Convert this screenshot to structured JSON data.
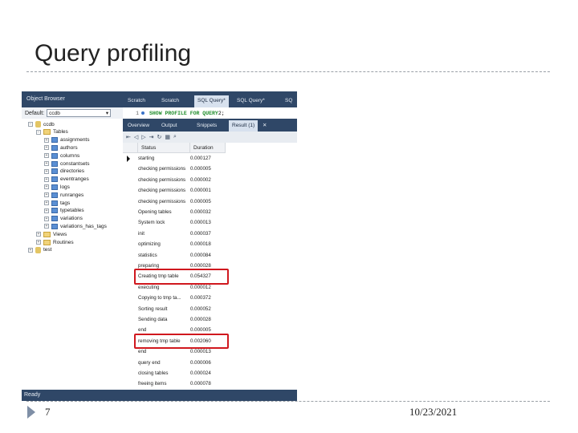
{
  "slide": {
    "title": "Query profiling",
    "page_number": "7",
    "date": "10/23/2021"
  },
  "object_browser": {
    "header": "Object Browser",
    "default_label": "Default:",
    "default_value": "ccdb",
    "tree": [
      {
        "label": "ccdb",
        "type": "db",
        "expander": "−"
      },
      {
        "label": "Tables",
        "type": "folder",
        "expander": "−"
      },
      {
        "label": "assignments",
        "type": "table",
        "expander": "+"
      },
      {
        "label": "authors",
        "type": "table",
        "expander": "+"
      },
      {
        "label": "columns",
        "type": "table",
        "expander": "+"
      },
      {
        "label": "constantsets",
        "type": "table",
        "expander": "+"
      },
      {
        "label": "directories",
        "type": "table",
        "expander": "+"
      },
      {
        "label": "eventranges",
        "type": "table",
        "expander": "+"
      },
      {
        "label": "logs",
        "type": "table",
        "expander": "+"
      },
      {
        "label": "runranges",
        "type": "table",
        "expander": "+"
      },
      {
        "label": "tags",
        "type": "table",
        "expander": "+"
      },
      {
        "label": "typetables",
        "type": "table",
        "expander": "+"
      },
      {
        "label": "variations",
        "type": "table",
        "expander": "+"
      },
      {
        "label": "variations_has_tags",
        "type": "table",
        "expander": "+"
      },
      {
        "label": "Views",
        "type": "folder",
        "expander": "+"
      },
      {
        "label": "Routines",
        "type": "folder",
        "expander": "+"
      },
      {
        "label": "test",
        "type": "db",
        "expander": "+"
      }
    ]
  },
  "editor_tabs": [
    {
      "label": "Scratch"
    },
    {
      "label": "Scratch"
    },
    {
      "label": "SQL Query*"
    },
    {
      "label": "SQL Query*"
    },
    {
      "label": "SQ"
    }
  ],
  "editor": {
    "line_number": "1",
    "kw1": "SHOW PROFILE FOR QUERY",
    "rest": " 2;"
  },
  "result_tabs": [
    {
      "label": "Overview"
    },
    {
      "label": "Output"
    },
    {
      "label": "Snippets"
    },
    {
      "label": "Result (1)"
    },
    {
      "label": "✕"
    }
  ],
  "grid": {
    "headers": {
      "status": "Status",
      "duration": "Duration"
    },
    "rows": [
      {
        "status": "starting",
        "duration": "0.000127"
      },
      {
        "status": "checking permissions",
        "duration": "0.000005"
      },
      {
        "status": "checking permissions",
        "duration": "0.000002"
      },
      {
        "status": "checking permissions",
        "duration": "0.000001"
      },
      {
        "status": "checking permissions",
        "duration": "0.000005"
      },
      {
        "status": "Opening tables",
        "duration": "0.000032"
      },
      {
        "status": "System lock",
        "duration": "0.000013"
      },
      {
        "status": "init",
        "duration": "0.000037"
      },
      {
        "status": "optimizing",
        "duration": "0.000018"
      },
      {
        "status": "statistics",
        "duration": "0.000084"
      },
      {
        "status": "preparing",
        "duration": "0.000028"
      },
      {
        "status": "Creating tmp table",
        "duration": "0.054327"
      },
      {
        "status": "executing",
        "duration": "0.000012"
      },
      {
        "status": "Copying to tmp ta...",
        "duration": "0.000372"
      },
      {
        "status": "Sorting result",
        "duration": "0.000052"
      },
      {
        "status": "Sending data",
        "duration": "0.000028"
      },
      {
        "status": "end",
        "duration": "0.000005"
      },
      {
        "status": "removing tmp table",
        "duration": "0.002060"
      },
      {
        "status": "end",
        "duration": "0.000013"
      },
      {
        "status": "query end",
        "duration": "0.000006"
      },
      {
        "status": "closing tables",
        "duration": "0.000024"
      },
      {
        "status": "freeing items",
        "duration": "0.000078"
      }
    ]
  },
  "status_bar": "Ready",
  "colors": {
    "highlight": "#d0181e",
    "chrome": "#2f4767"
  }
}
